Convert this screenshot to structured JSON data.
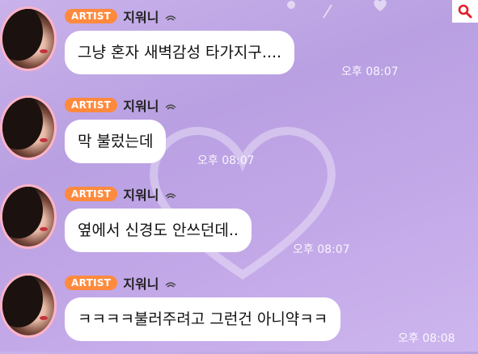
{
  "icons": {
    "search": "search-icon",
    "sender_status": "ripple-icon"
  },
  "colors": {
    "badge": "#ff8a3d",
    "bubble": "#ffffff",
    "background": "#c3a8e8"
  },
  "messages": [
    {
      "badge": "ARTIST",
      "sender": "지워니",
      "text": "그냥 혼자 새벽감성 타가지구....",
      "time": "오후 08:07"
    },
    {
      "badge": "ARTIST",
      "sender": "지워니",
      "text": "막 불렀는데",
      "time": "오후 08:07"
    },
    {
      "badge": "ARTIST",
      "sender": "지워니",
      "text": "옆에서 신경도 안쓰던데..",
      "time": "오후 08:07"
    },
    {
      "badge": "ARTIST",
      "sender": "지워니",
      "text": "ㅋㅋㅋㅋ불러주려고 그런건 아니약ㅋㅋ",
      "time": "오후 08:08"
    }
  ]
}
